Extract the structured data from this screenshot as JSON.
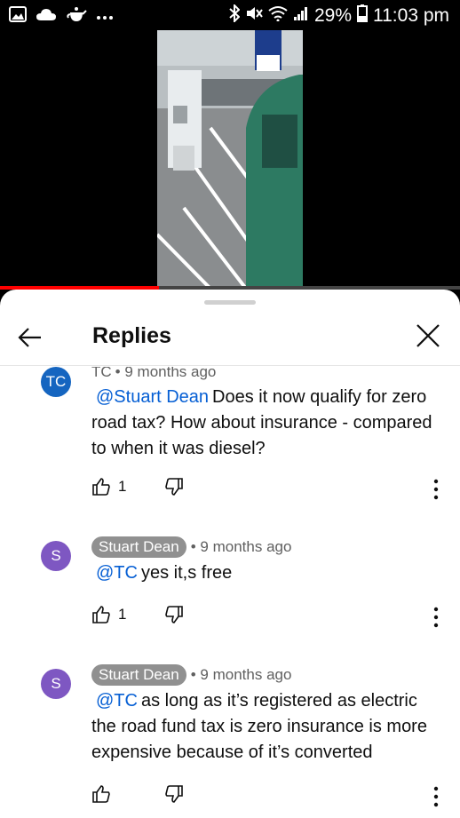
{
  "status_bar": {
    "left_icons": [
      "image-icon",
      "cloud-icon",
      "teapot-icon",
      "more-dots-icon"
    ],
    "right_icons": [
      "bluetooth-icon",
      "mute-icon",
      "wifi-icon",
      "signal-icon"
    ],
    "battery_percent": "29%",
    "time": "11:03 pm"
  },
  "video": {
    "progress_fraction": 0.345
  },
  "sheet": {
    "title": "Replies"
  },
  "comments": [
    {
      "avatar": "TC",
      "avatar_color": "#1565c0",
      "author": "TC",
      "author_style": "plain",
      "time": "9 months ago",
      "mention": "@Stuart Dean",
      "text_first": "Does it now qualify for zero",
      "text_rest": [
        "road tax? How about insurance - compared",
        "to when it was diesel?"
      ],
      "likes": "1"
    },
    {
      "avatar": "S",
      "avatar_color": "#7e57c2",
      "author": "Stuart Dean",
      "author_style": "chip",
      "time": "9 months ago",
      "mention": "@TC",
      "text_first": "yes it,s free",
      "text_rest": [],
      "likes": "1"
    },
    {
      "avatar": "S",
      "avatar_color": "#7e57c2",
      "author": "Stuart Dean",
      "author_style": "chip",
      "time": "9 months ago",
      "mention": "@TC",
      "text_first": "as long as it’s registered as electric",
      "text_rest": [
        "the road fund tax is zero insurance is more",
        "expensive because of it’s converted"
      ],
      "likes": ""
    }
  ]
}
